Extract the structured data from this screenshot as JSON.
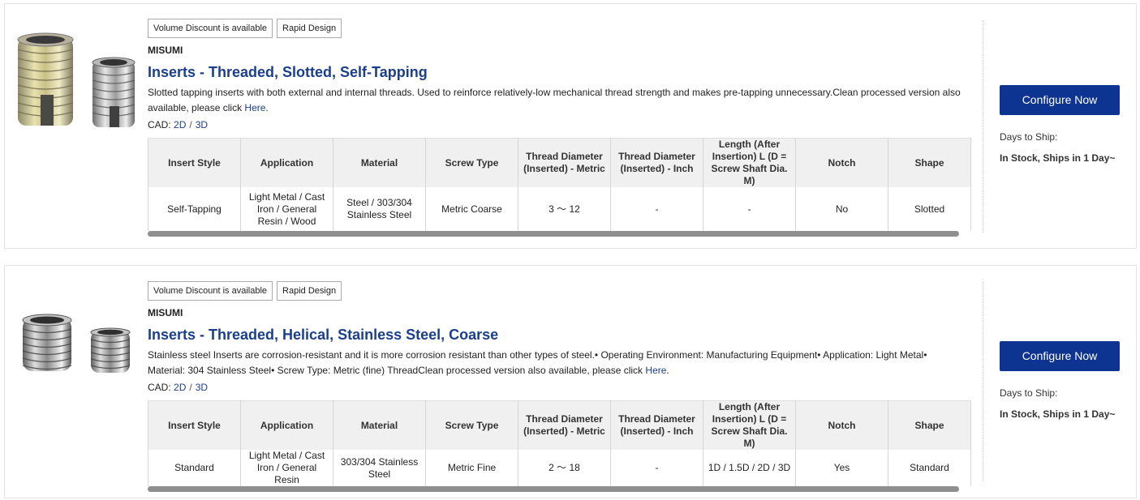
{
  "products": [
    {
      "tags": [
        "Volume Discount is available",
        "Rapid Design"
      ],
      "brand": "MISUMI",
      "title": "Inserts - Threaded, Slotted, Self-Tapping",
      "description_lines": [
        "Slotted tapping inserts with both external and internal threads. Used to reinforce relatively-low mechanical thread strength and makes pre-tapping unnecessary.Clean processed version also",
        "available, please click"
      ],
      "description_link": "Here",
      "description_end": ".",
      "cad_label": "CAD:",
      "cad_links": [
        "2D",
        "3D"
      ],
      "cad_sep": "/",
      "columns": [
        "Insert Style",
        "Application",
        "Material",
        "Screw Type",
        "Thread Diameter (Inserted) - Metric",
        "Thread Diameter (Inserted) - Inch",
        "Length (After Insertion) L (D = Screw Shaft Dia. M)",
        "Notch",
        "Shape"
      ],
      "values": [
        "Self-Tapping",
        "Light Metal / Cast Iron / General Resin / Wood",
        "Steel / 303/304 Stainless Steel",
        "Metric Coarse",
        "3 ～ 12",
        "-",
        "-",
        "No",
        "Slotted"
      ],
      "configure_label": "Configure Now",
      "days_label": "Days to Ship:",
      "days_value": "In Stock, Ships in 1 Day~"
    },
    {
      "tags": [
        "Volume Discount is available",
        "Rapid Design"
      ],
      "brand": "MISUMI",
      "title": "Inserts - Threaded, Helical, Stainless Steel, Coarse",
      "description_lines": [
        "Stainless steel Inserts are corrosion-resistant and it is more corrosion resistant than other types of steel.• Operating Environment: Manufacturing Equipment• Application: Light Metal•",
        "Material: 304 Stainless Steel• Screw Type: Metric (fine) ThreadClean processed version also available, please click"
      ],
      "description_link": "Here",
      "description_end": ".",
      "cad_label": "CAD:",
      "cad_links": [
        "2D",
        "3D"
      ],
      "cad_sep": "/",
      "columns": [
        "Insert Style",
        "Application",
        "Material",
        "Screw Type",
        "Thread Diameter (Inserted) - Metric",
        "Thread Diameter (Inserted) - Inch",
        "Length (After Insertion) L (D = Screw Shaft Dia. M)",
        "Notch",
        "Shape"
      ],
      "values": [
        "Standard",
        "Light Metal / Cast Iron / General Resin",
        "303/304 Stainless Steel",
        "Metric Fine",
        "2 ～ 18",
        "-",
        "1D / 1.5D / 2D / 3D",
        "Yes",
        "Standard"
      ],
      "configure_label": "Configure Now",
      "days_label": "Days to Ship:",
      "days_value": "In Stock, Ships in 1 Day~"
    }
  ],
  "colors": {
    "title": "#1b3f8b",
    "button": "#0d3490",
    "header_bg": "#f0f0f0",
    "scroll_thumb": "#8f8f8f"
  },
  "icons": [
    "slotted-insert-image",
    "helical-insert-image"
  ]
}
